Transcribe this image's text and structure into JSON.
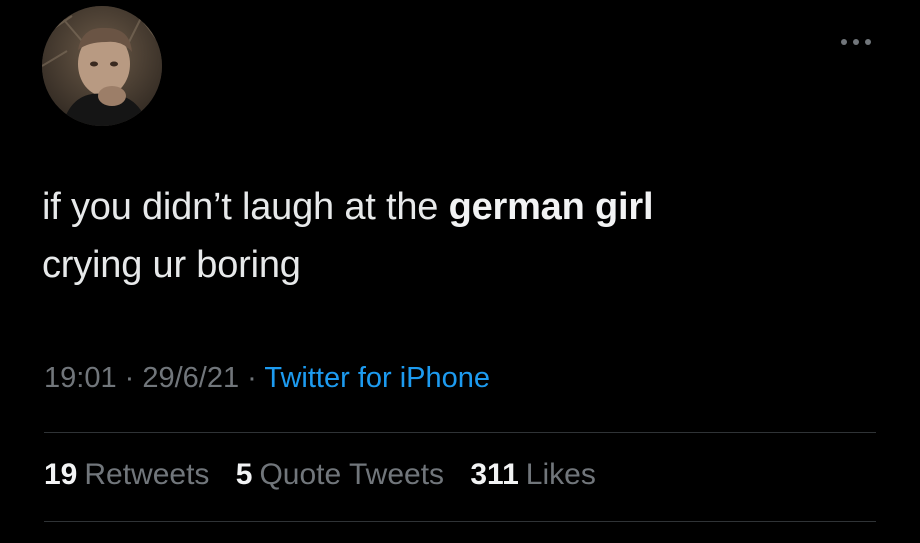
{
  "tweet": {
    "text_part1": "if you didn’t laugh at the ",
    "text_bold": "german girl",
    "text_part2": "crying ur boring"
  },
  "meta": {
    "time": "19:01",
    "date": "29/6/21",
    "separator": " · ",
    "source": "Twitter for iPhone"
  },
  "stats": {
    "retweets_count": "19",
    "retweets_label": "Retweets",
    "quotes_count": "5",
    "quotes_label": "Quote Tweets",
    "likes_count": "311",
    "likes_label": "Likes"
  },
  "icons": {
    "more": "more-horizontal-icon",
    "avatar": "profile-photo"
  },
  "colors": {
    "background": "#000000",
    "text": "#e7e9ea",
    "muted": "#71767b",
    "link": "#1d9bf0",
    "divider": "#2f3336"
  }
}
